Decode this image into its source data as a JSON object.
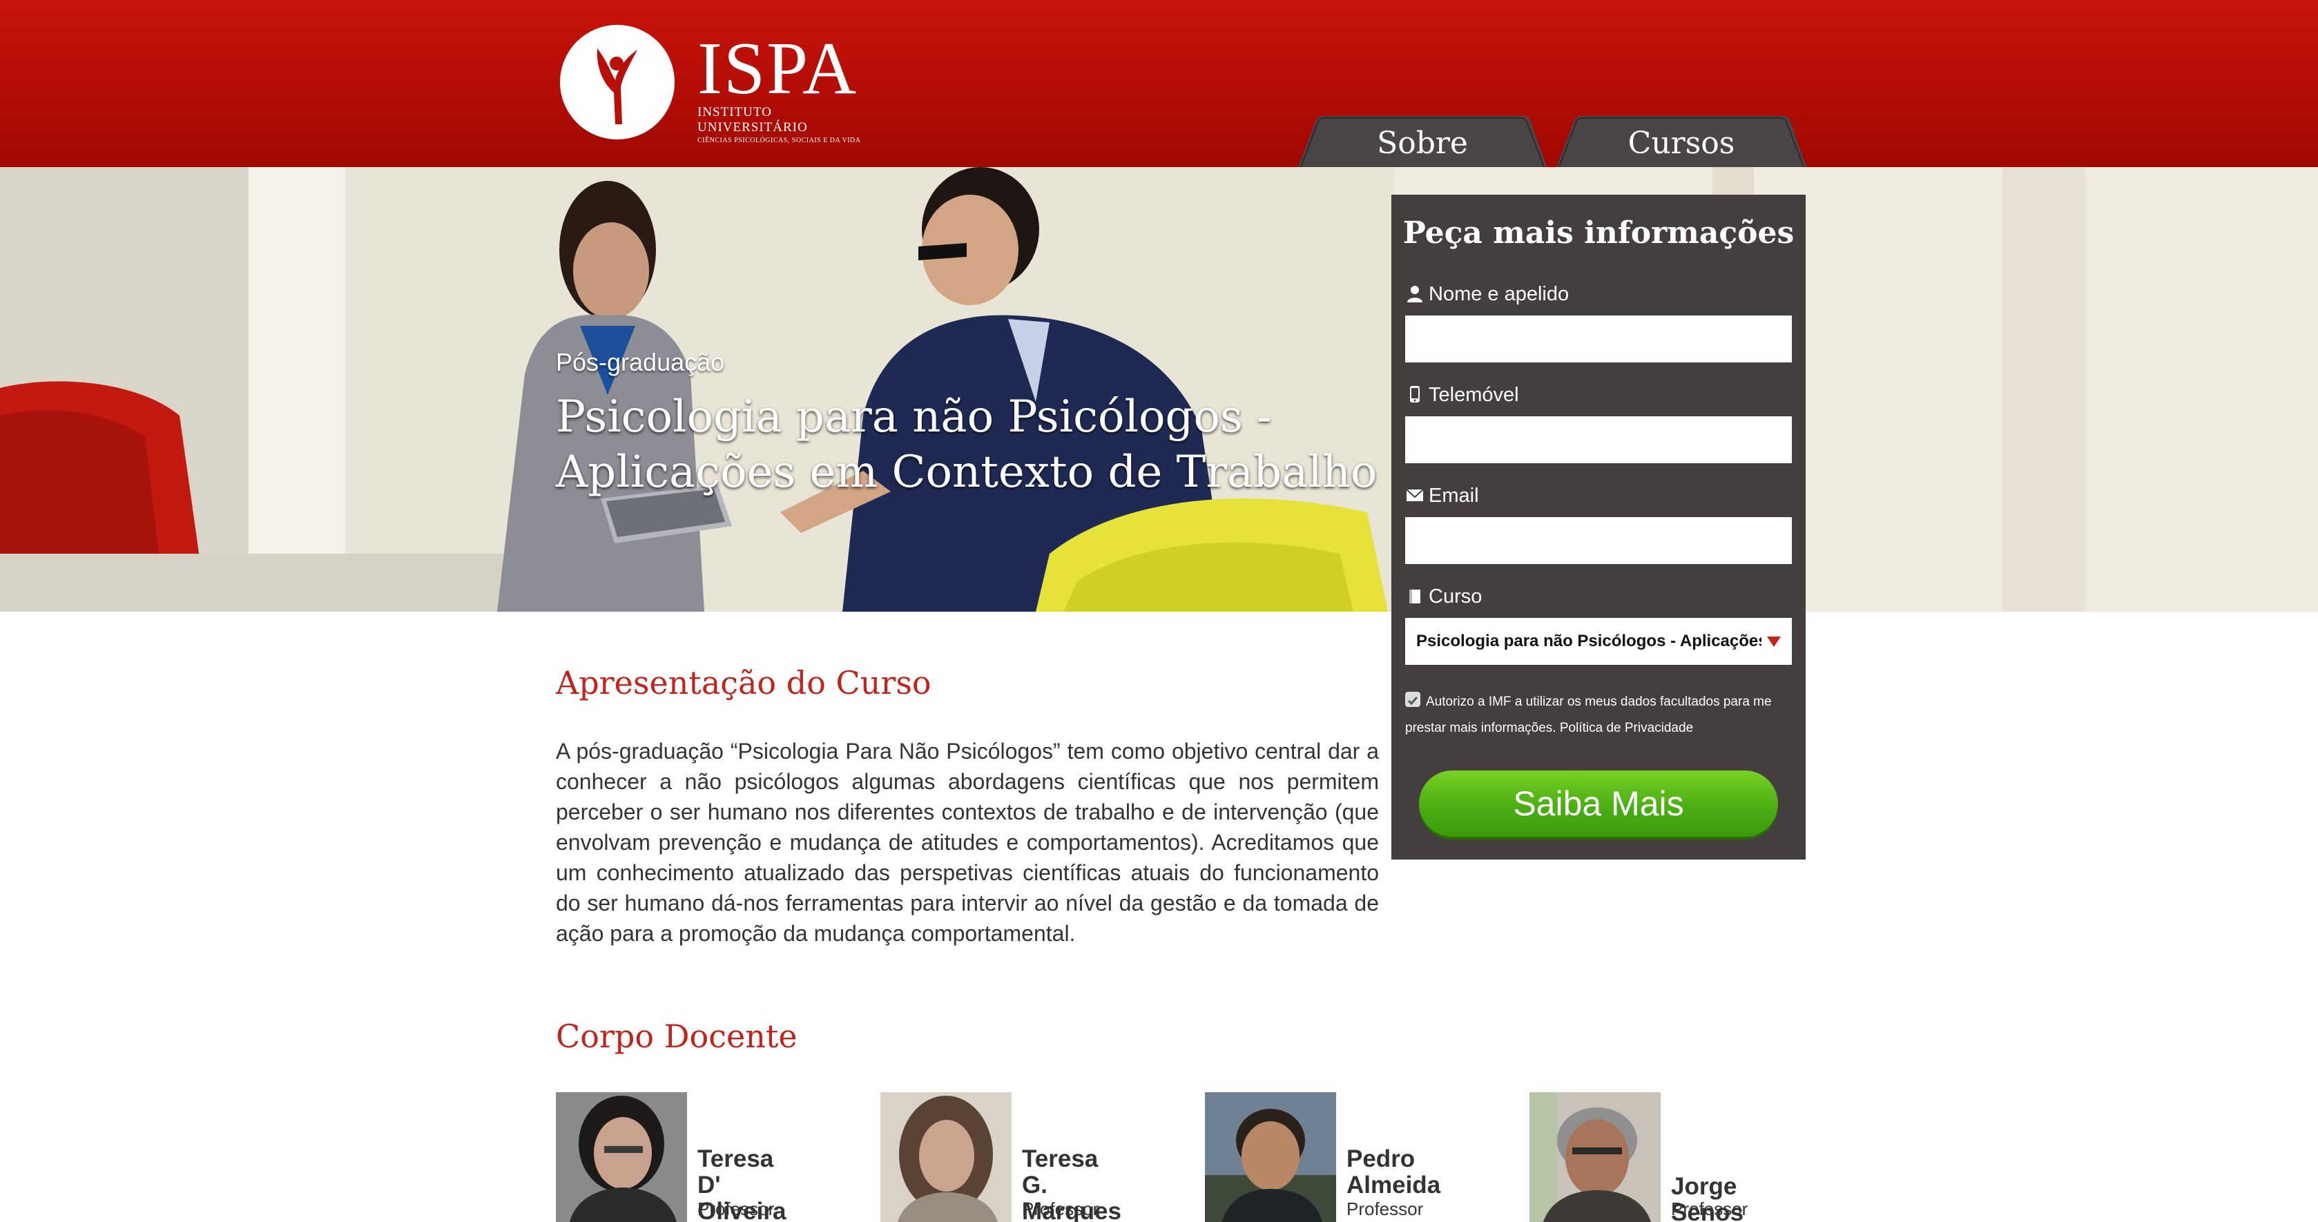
{
  "header": {
    "logo": {
      "word": "ISPA",
      "subtitle": "INSTITUTO UNIVERSITÁRIO",
      "tagline": "CIÊNCIAS PSICOLÓGICAS, SOCIAIS E DA VIDA"
    },
    "nav": [
      {
        "label": "Sobre"
      },
      {
        "label": "Cursos"
      }
    ]
  },
  "hero": {
    "kicker": "Pós-graduação",
    "title_line1": "Psicologia para não Psicólogos -",
    "title_line2": "Aplicações em Contexto de Trabalho"
  },
  "form": {
    "title": "Peça mais informações",
    "fields": [
      {
        "label": "Nome e apelido",
        "icon": "user-icon",
        "value": ""
      },
      {
        "label": "Telemóvel",
        "icon": "phone-icon",
        "value": ""
      },
      {
        "label": "Email",
        "icon": "envelope-icon",
        "value": ""
      },
      {
        "label": "Curso",
        "icon": "book-icon",
        "value": "Psicologia para não Psicólogos - Aplicações em Contexto de Trabalho"
      }
    ],
    "consent_text": "Autorizo a IMF a utilizar os meus dados facultados para me prestar mais informações.",
    "privacy_link": "Política de Privacidade",
    "submit_label": "Saiba Mais"
  },
  "presentation": {
    "title": "Apresentação do Curso",
    "text": "A pós-graduação “Psicologia Para Não Psicólogos” tem como objetivo central dar a conhecer a não psicólogos algumas abordagens científicas que nos permitem perceber o ser humano nos diferentes contextos de trabalho e de intervenção (que envolvam prevenção e mudança de atitudes e comportamentos). Acreditamos que um conhecimento atualizado das perspetivas científicas atuais do funcionamento do ser humano dá-nos ferramentas para intervir ao nível da gestão e da tomada de ação para a promoção da mudança comportamental."
  },
  "faculty": {
    "title": "Corpo Docente",
    "members": [
      {
        "name_line1": "Teresa D'",
        "name_line2": "Oliveira",
        "role": "Professor Auxiliar"
      },
      {
        "name_line1": "Teresa G.",
        "name_line2": "Marques",
        "role": "Professor Auxiliar"
      },
      {
        "name_line1": "Pedro",
        "name_line2": "Almeida",
        "role": "Professor Auxiliar"
      },
      {
        "name_line1": "",
        "name_line2": "Jorge Senos",
        "role": "Professor Auxiliar"
      }
    ]
  },
  "colors": {
    "brand_red": "#b80f08",
    "form_bg": "#453e3f",
    "accent_title": "#c0241b",
    "button_green": "#4bae13"
  }
}
